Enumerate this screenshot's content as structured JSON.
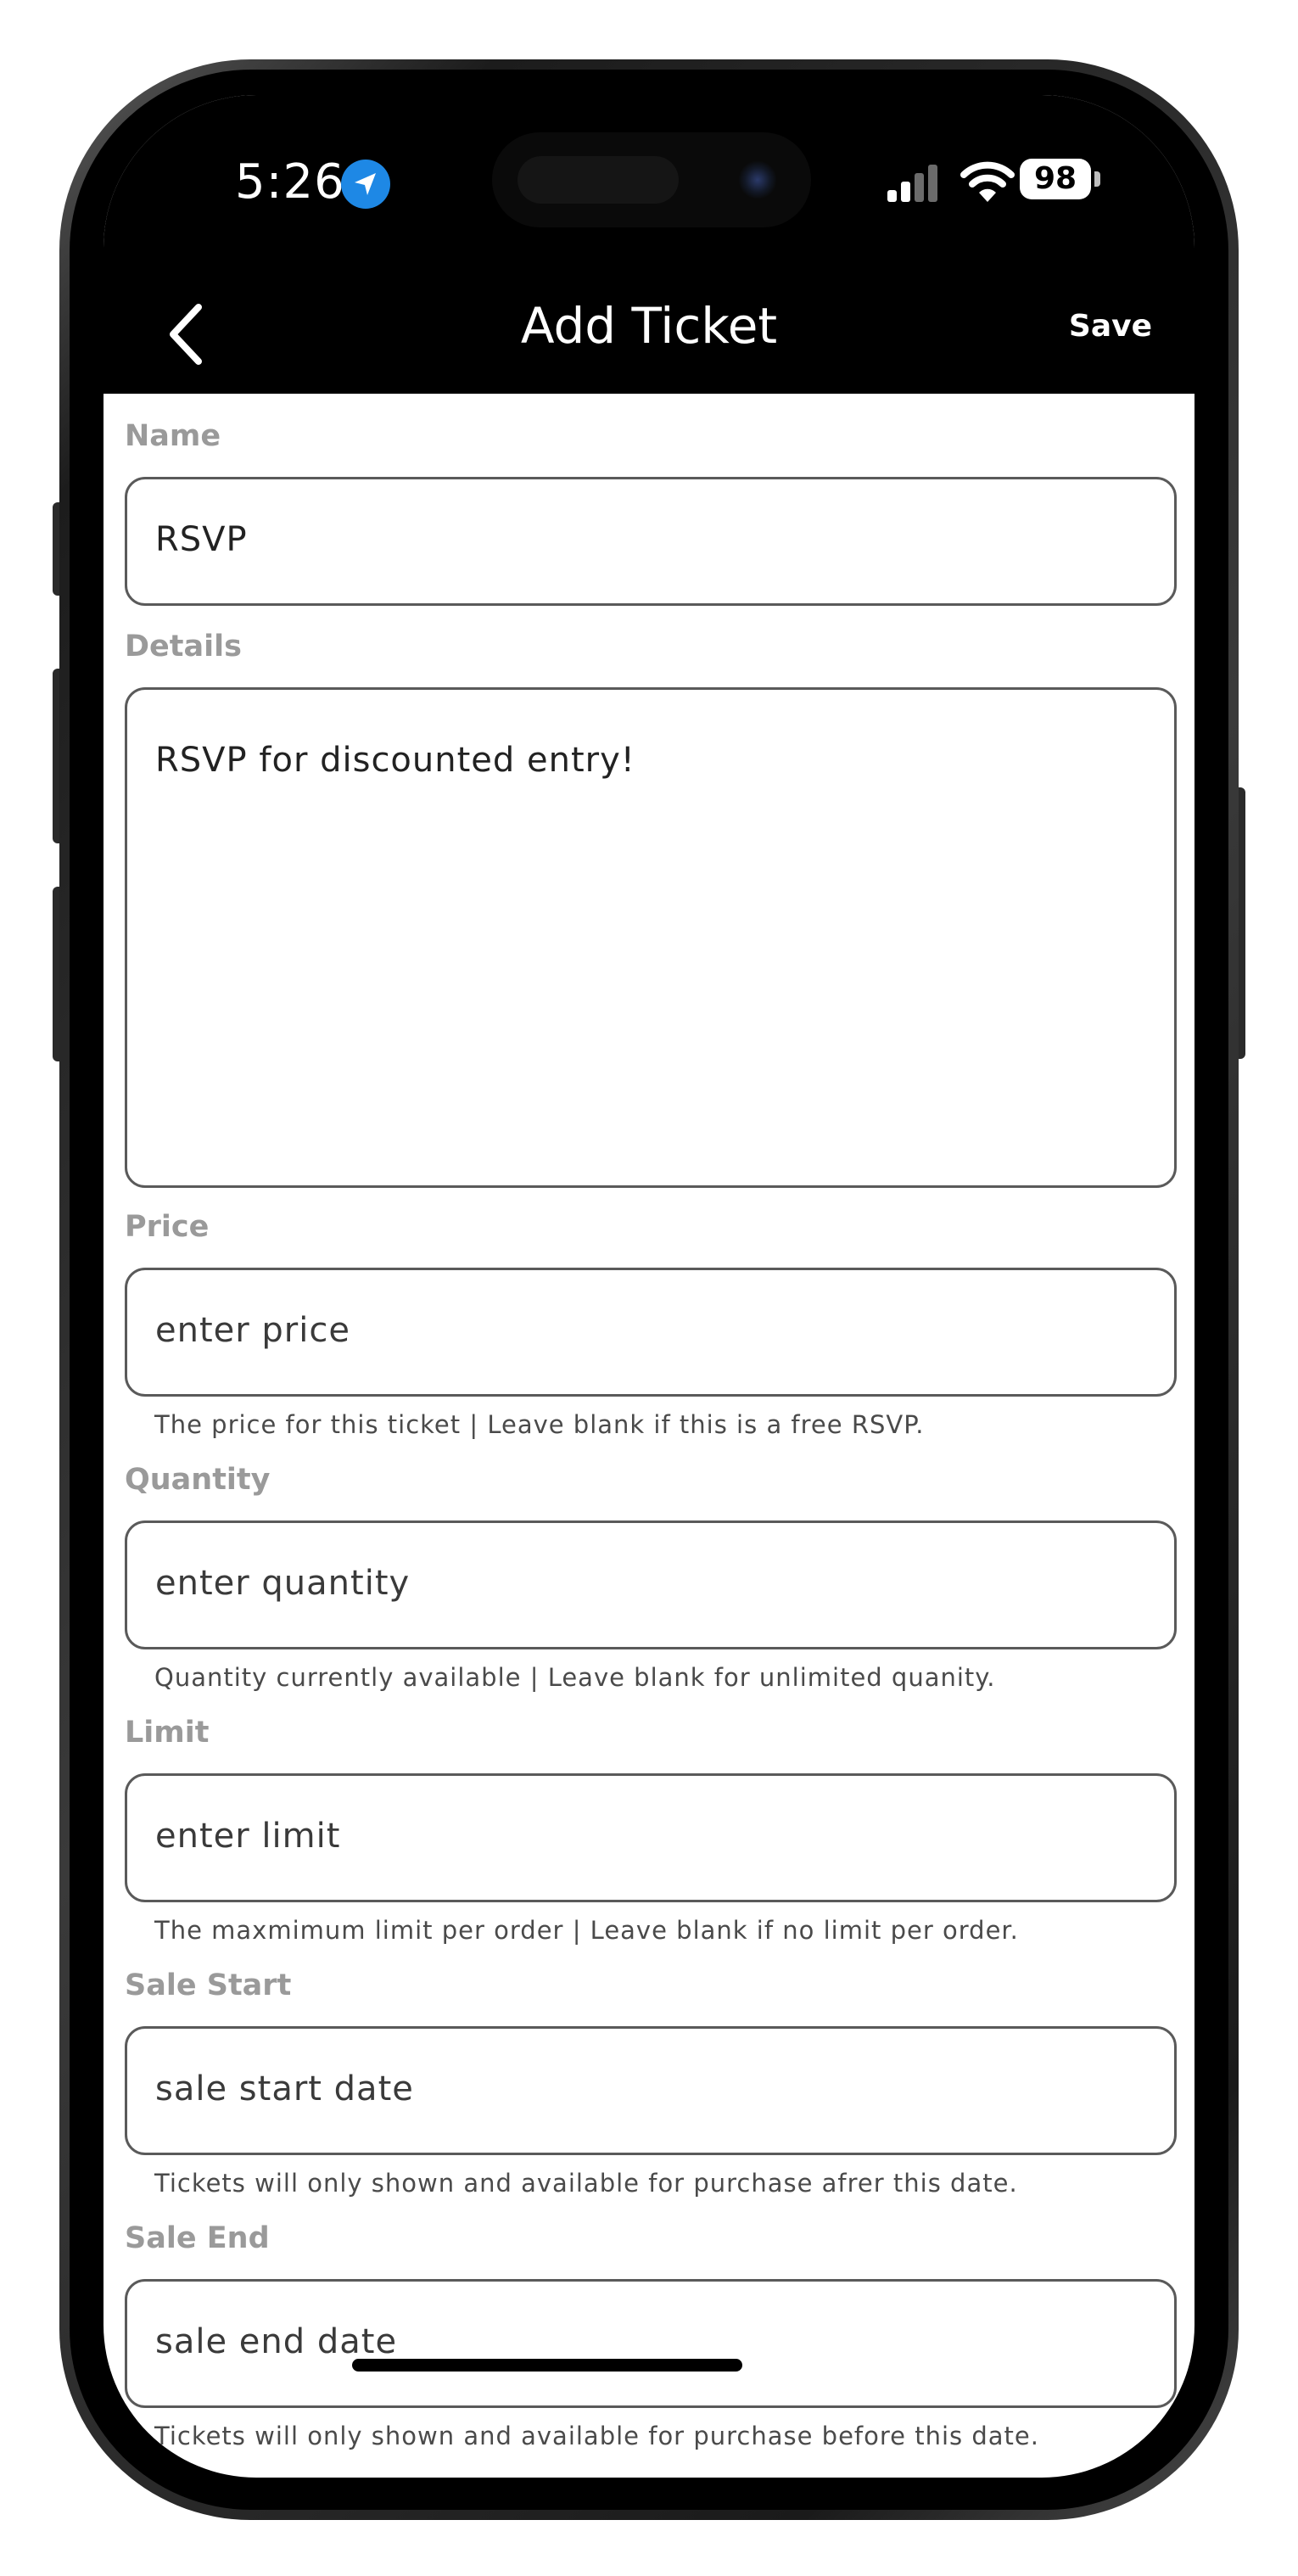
{
  "status_bar": {
    "time": "5:26",
    "battery": "98",
    "location_icon": "location-arrow-icon",
    "signal_icon": "cellular-signal-icon",
    "wifi_icon": "wifi-icon",
    "accent_color": "#1e88e5"
  },
  "nav": {
    "back_icon": "chevron-left-icon",
    "title": "Add Ticket",
    "save_label": "Save"
  },
  "form": {
    "name": {
      "label": "Name",
      "value": "RSVP"
    },
    "details": {
      "label": "Details",
      "value": "RSVP for discounted entry!"
    },
    "price": {
      "label": "Price",
      "placeholder": "enter price",
      "helper": "The price for this ticket | Leave blank if this is a free RSVP."
    },
    "quantity": {
      "label": "Quantity",
      "placeholder": "enter quantity",
      "helper": "Quantity currently available | Leave blank for unlimited quanity."
    },
    "limit": {
      "label": "Limit",
      "placeholder": "enter limit",
      "helper": "The maxmimum limit per order | Leave blank if no limit per order."
    },
    "sale_start": {
      "label": "Sale Start",
      "placeholder": "sale start date",
      "helper": "Tickets will only shown and available for purchase afrer this date."
    },
    "sale_end": {
      "label": "Sale End",
      "placeholder": "sale end date",
      "helper": "Tickets will only shown and available for purchase before this date."
    }
  }
}
